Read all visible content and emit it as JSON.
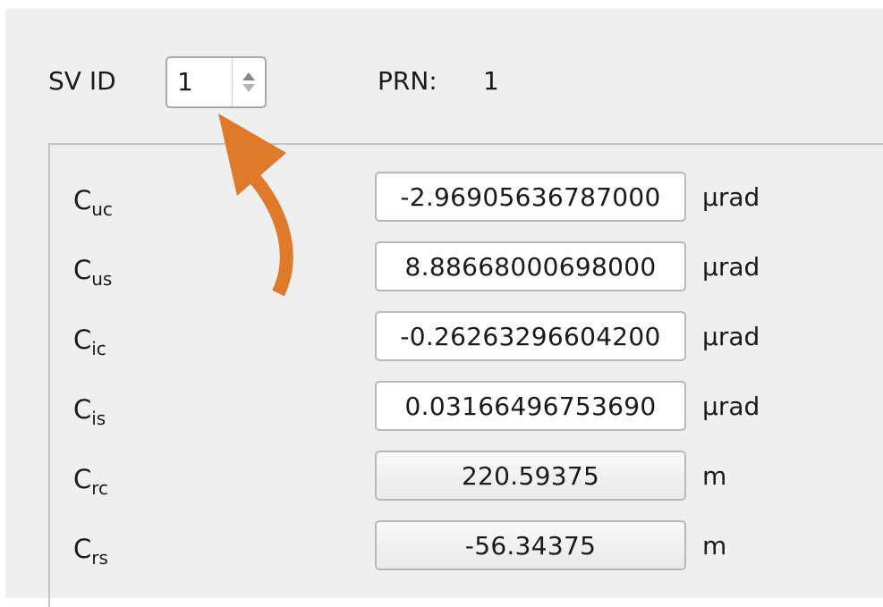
{
  "header": {
    "sv_id_label": "SV ID",
    "sv_id_value": "1",
    "prn_label": "PRN:",
    "prn_value": "1"
  },
  "rows": [
    {
      "symbol": "C",
      "subscript": "uc",
      "value": "-2.96905636787000",
      "unit": "µrad",
      "editable": true
    },
    {
      "symbol": "C",
      "subscript": "us",
      "value": "8.88668000698000",
      "unit": "µrad",
      "editable": true
    },
    {
      "symbol": "C",
      "subscript": "ic",
      "value": "-0.26263296604200",
      "unit": "µrad",
      "editable": true
    },
    {
      "symbol": "C",
      "subscript": "is",
      "value": "0.03166496753690",
      "unit": "µrad",
      "editable": true
    },
    {
      "symbol": "C",
      "subscript": "rc",
      "value": "220.59375",
      "unit": "m",
      "editable": false
    },
    {
      "symbol": "C",
      "subscript": "rs",
      "value": "-56.34375",
      "unit": "m",
      "editable": false
    }
  ],
  "colors": {
    "annotation_arrow": "#e07a2b"
  },
  "icons": {
    "spin_up": "triangle-up-icon",
    "spin_down": "triangle-down-icon",
    "annotation": "curved-arrow-icon"
  }
}
